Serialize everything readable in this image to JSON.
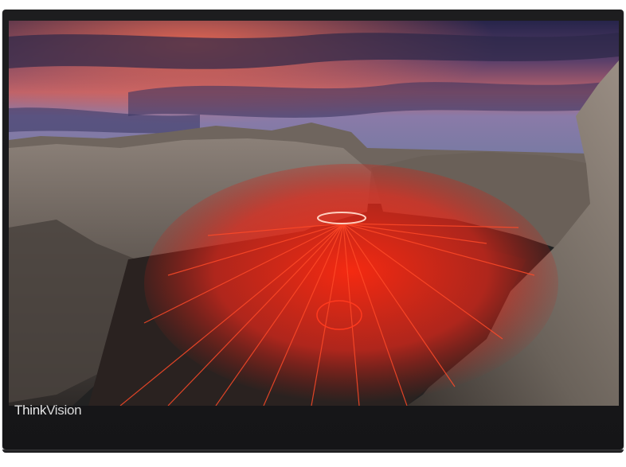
{
  "device": {
    "brand_think": "Think",
    "brand_vision": "Vision",
    "colors": {
      "bezel": "#1b1b1d",
      "sky_top": "#2d2a52",
      "sky_glow": "#e86a5c",
      "rock": "#7a7066",
      "sparks": "#ff3a1e"
    }
  },
  "screen": {
    "scene": "canyon-steel-wool-photo"
  }
}
